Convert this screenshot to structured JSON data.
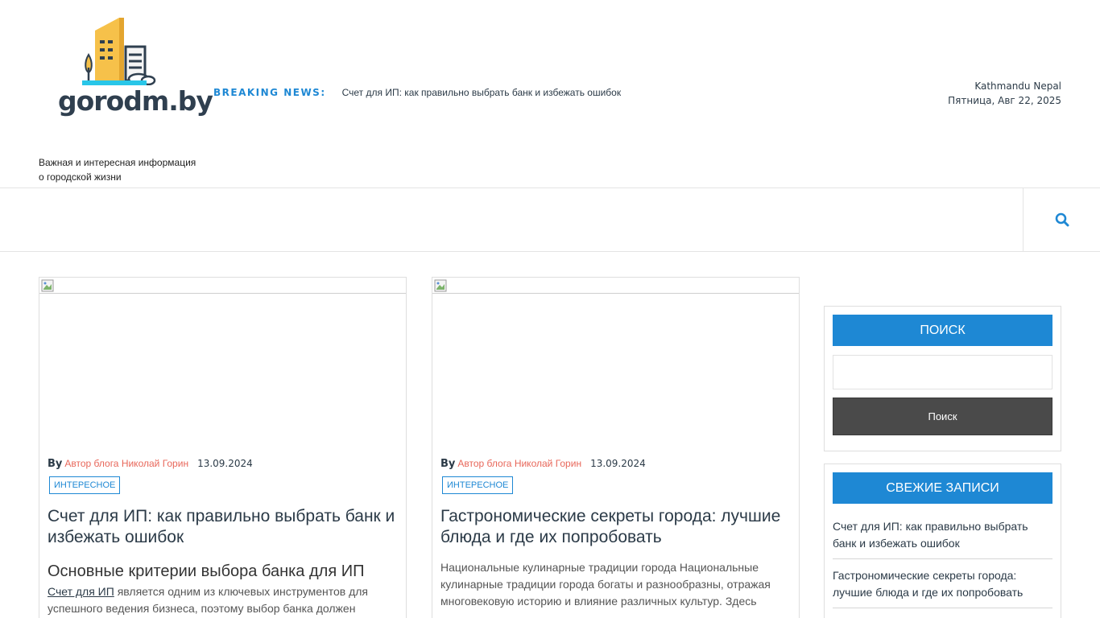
{
  "site": {
    "logo_text": "gorodm.by",
    "tagline": "Важная и интересная информация о городской жизни"
  },
  "breaking": {
    "label": "BREAKING NEWS:",
    "headline": "Счет для ИП: как правильно выбрать банк и избежать ошибок"
  },
  "header_info": {
    "location": "Kathmandu Nepal",
    "date": "Пятница, Авг 22, 2025"
  },
  "nav": {
    "search_icon": "search-icon"
  },
  "posts": [
    {
      "by": "By",
      "author": "Автор блога Николай Горин",
      "date": "13.09.2024",
      "category": "ИНТЕРЕСНОЕ",
      "title": "Счет для ИП: как правильно выбрать банк и избежать ошибок",
      "subtitle": "Основные критерии выбора банка для ИП",
      "excerpt_link": "Счет для ИП",
      "excerpt": " является одним из ключевых инструментов для успешного ведения бизнеса, поэтому выбор банка должен"
    },
    {
      "by": "By",
      "author": "Автор блога Николай Горин",
      "date": "13.09.2024",
      "category": "ИНТЕРЕСНОЕ",
      "title": "Гастрономические секреты города: лучшие блюда и где их попробовать",
      "excerpt": "Национальные кулинарные традиции города Национальные кулинарные традиции города богаты и разнообразны, отражая многовековую историю и влияние различных культур. Здесь"
    }
  ],
  "sidebar": {
    "search": {
      "heading": "ПОИСК",
      "placeholder": "",
      "button": "Поиск"
    },
    "recent": {
      "heading": "СВЕЖИЕ ЗАПИСИ",
      "items": [
        "Счет для ИП: как правильно выбрать банк и избежать ошибок",
        "Гастрономические секреты города: лучшие блюда и где их попробовать"
      ]
    }
  },
  "colors": {
    "accent": "#1e88d4",
    "author": "#e8675a",
    "dark_text": "#2b3a47",
    "button_bg": "#4a4a4a"
  }
}
